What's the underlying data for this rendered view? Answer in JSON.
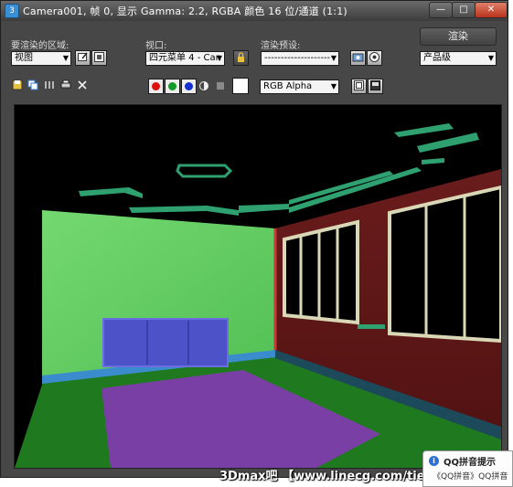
{
  "window": {
    "title": "Camera001, 帧 0, 显示 Gamma: 2.2, RGBA 颜色 16 位/通道 (1:1)",
    "app_icon_glyph": "3",
    "minimize_glyph": "—",
    "maximize_glyph": "□",
    "close_glyph": "✕"
  },
  "toolbar": {
    "area_label": "要渲染的区域:",
    "area_value": "视图",
    "viewport_label": "视口:",
    "viewport_value": "四元菜单 4 - Can",
    "preset_label": "渲染预设:",
    "preset_value": "--------------------",
    "render_button": "渲染",
    "quality_value": "产品级",
    "dropdown_arrow": "▼",
    "lock_glyph": "🔒",
    "channel_value": "RGB Alpha"
  },
  "channels": {
    "red_color": "#dd1010",
    "green_color": "#129a2a",
    "blue_color": "#1530d0"
  },
  "scene": {
    "colors": {
      "left_wall": "#5ec95a",
      "right_wall": "#5c1515",
      "floor": "#1f7a1f",
      "rug": "#7a3fa5",
      "panel": "#4e52c8",
      "baseboard": "#3b8ccd",
      "ceiling_trim": "#2fa070",
      "window_frame": "#d9d7b5"
    }
  },
  "watermark": "3Dmax吧  【www.linecg.com/tieba/】",
  "qq_popup": {
    "icon_glyph": "i",
    "title": "QQ拼音提示",
    "body": "《QQ拼音》QQ拼音"
  }
}
